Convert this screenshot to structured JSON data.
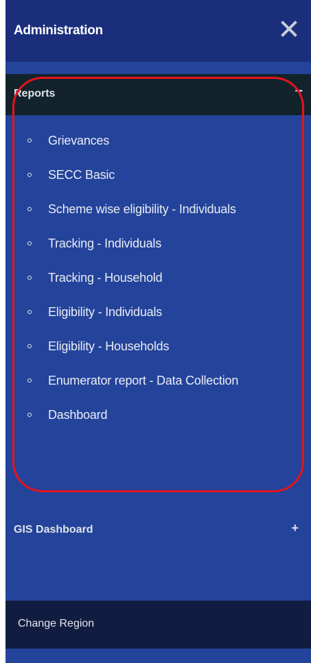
{
  "header": {
    "title": "Administration",
    "close_icon": "close-icon"
  },
  "reports": {
    "label": "Reports",
    "toggle": "−",
    "items": [
      {
        "label": "Grievances"
      },
      {
        "label": "SECC Basic"
      },
      {
        "label": "Scheme wise eligibility - Individuals"
      },
      {
        "label": "Tracking - Individuals"
      },
      {
        "label": "Tracking - Household"
      },
      {
        "label": "Eligibility - Individuals"
      },
      {
        "label": "Eligibility - Households"
      },
      {
        "label": "Enumerator report - Data Collection"
      },
      {
        "label": "Dashboard"
      }
    ]
  },
  "gis": {
    "label": "GIS Dashboard",
    "toggle": "+"
  },
  "footer": {
    "change_region_label": "Change Region"
  },
  "colors": {
    "panel_bg": "#24439a",
    "header_bg": "#1a2e7c",
    "reports_header_bg": "#13232c",
    "footer_bg": "#111d40",
    "highlight_border": "#e8131b"
  }
}
